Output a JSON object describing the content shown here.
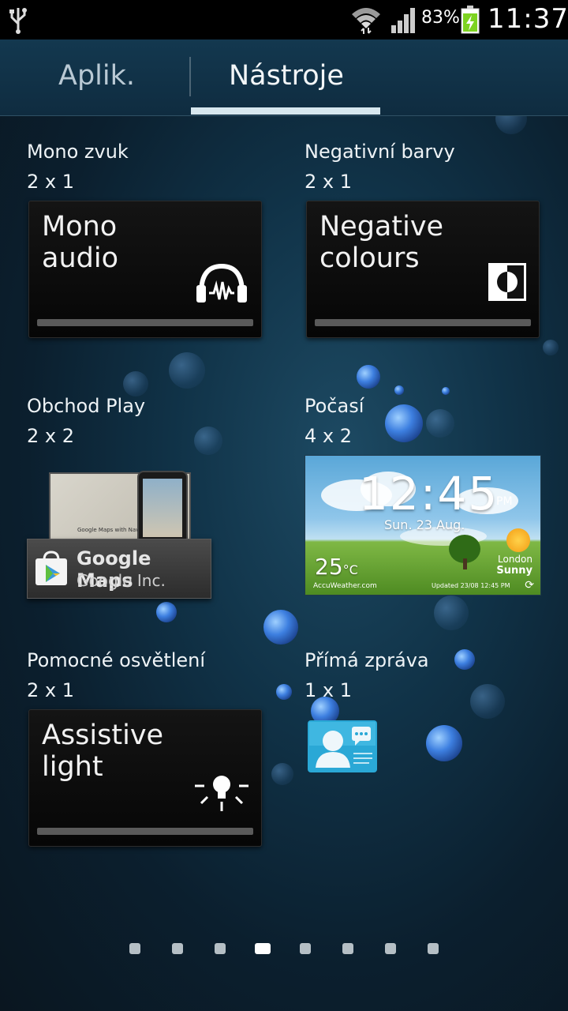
{
  "status_bar": {
    "battery_percent": "83%",
    "time": "11:37",
    "icons": [
      "usb-icon",
      "wifi-icon",
      "signal-icon",
      "battery-charging-icon"
    ]
  },
  "tabs": [
    {
      "label": "Aplik.",
      "selected": false
    },
    {
      "label": "Nástroje",
      "selected": true
    }
  ],
  "widgets": {
    "mono": {
      "name": "Mono zvuk",
      "size": "2 x 1",
      "preview_title": "Mono\naudio",
      "icon": "headphones-icon"
    },
    "negative": {
      "name": "Negativní barvy",
      "size": "2 x 1",
      "preview_title": "Negative\ncolours",
      "icon": "invert-colors-icon"
    },
    "play": {
      "name": "Obchod Play",
      "size": "2 x 2",
      "app_name": "Google Maps",
      "developer": "Google Inc.",
      "caption": "Google Maps with Navigation™",
      "icon": "play-store-bag-icon"
    },
    "weather": {
      "name": "Počasí",
      "size": "4 x 2",
      "time": "12:45",
      "ampm": "PM",
      "date": "Sun. 23 Aug.",
      "temp": "25",
      "temp_unit": "°C",
      "city": "London",
      "condition": "Sunny",
      "brand": "AccuWeather.com",
      "updated": "Updated 23/08 12:45 PM"
    },
    "assistive": {
      "name": "Pomocné osvětlení",
      "size": "2 x 1",
      "preview_title": "Assistive\nlight",
      "icon": "bulb-icon"
    },
    "direct_message": {
      "name": "Přímá zpráva",
      "size": "1 x 1",
      "icon": "contact-message-icon"
    }
  },
  "pagination": {
    "count": 8,
    "active_index": 3
  },
  "colors": {
    "tab_indicator": "#d7e7ee",
    "status_bar": "#000000",
    "battery_green": "#7ed321"
  }
}
